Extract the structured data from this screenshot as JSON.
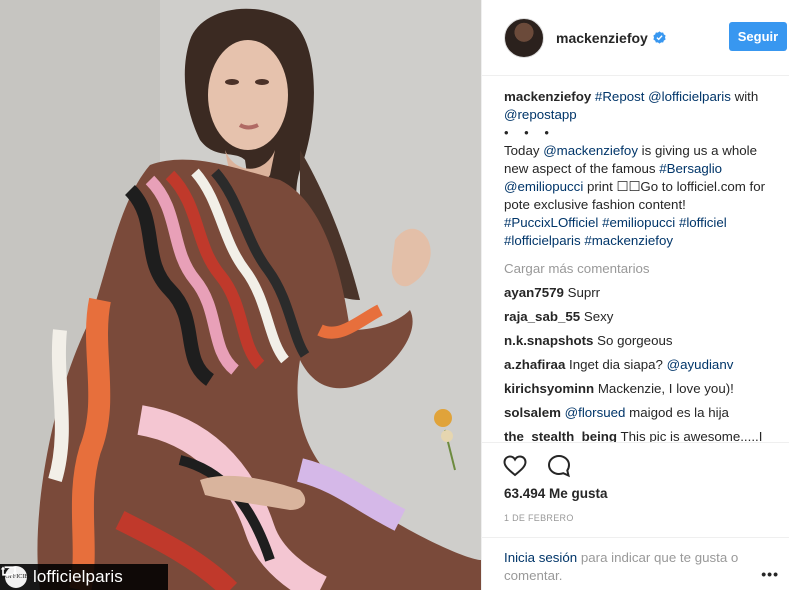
{
  "photo": {
    "repost_username": "lofficielparis",
    "repost_logo_text": "L'OFFICIEL"
  },
  "header": {
    "username": "mackenziefoy",
    "follow_label": "Seguir"
  },
  "caption": {
    "username": "mackenziefoy",
    "parts": {
      "repost_tag": "#Repost",
      "mention_1": "@lofficielparis",
      "with": " with",
      "mention_2": "@repostapp",
      "dots": "• • •",
      "today": "Today ",
      "mention_3": "@mackenziefoy",
      "text_1": " is giving us a whole new aspect of the famous ",
      "tag_1": "#Bersaglio",
      "mention_4": "@emiliopucci",
      "text_2": " print ☐☐Go to lofficiel.com for pote exclusive fashion content!",
      "tag_2": "#PuccixLOfficiel",
      "tag_3": "#emiliopucci",
      "tag_4": "#lofficiel",
      "tag_5": "#lofficielparis",
      "tag_6": "#mackenziefoy"
    }
  },
  "load_more": "Cargar más comentarios",
  "comments": [
    {
      "user": "ayan7579",
      "text": "Suprr"
    },
    {
      "user": "raja_sab_55",
      "text": "Sexy"
    },
    {
      "user": "n.k.snapshots",
      "text": "So gorgeous"
    },
    {
      "user": "a.zhafiraa",
      "text": "Inget dia siapa?",
      "mention": "@ayudianv"
    },
    {
      "user": "kirichsyominn",
      "text": "Mackenzie, I love you)!"
    },
    {
      "user": "solsalem",
      "mention": "@florsued",
      "text": "maigod es la hija"
    },
    {
      "user": "the_stealth_being",
      "text": "This pic is awesome.....I"
    }
  ],
  "likes": "63.494 Me gusta",
  "date": "1 DE FEBRERO",
  "login": {
    "link": "Inicia sesión",
    "text": " para indicar que te gusta o comentar."
  },
  "more_options": "•••",
  "colors": {
    "accent": "#3897f0",
    "link": "#003569",
    "muted": "#999999"
  },
  "icons": [
    "repost-icon",
    "verified-badge-icon",
    "heart-icon",
    "comment-icon",
    "more-options-icon"
  ]
}
